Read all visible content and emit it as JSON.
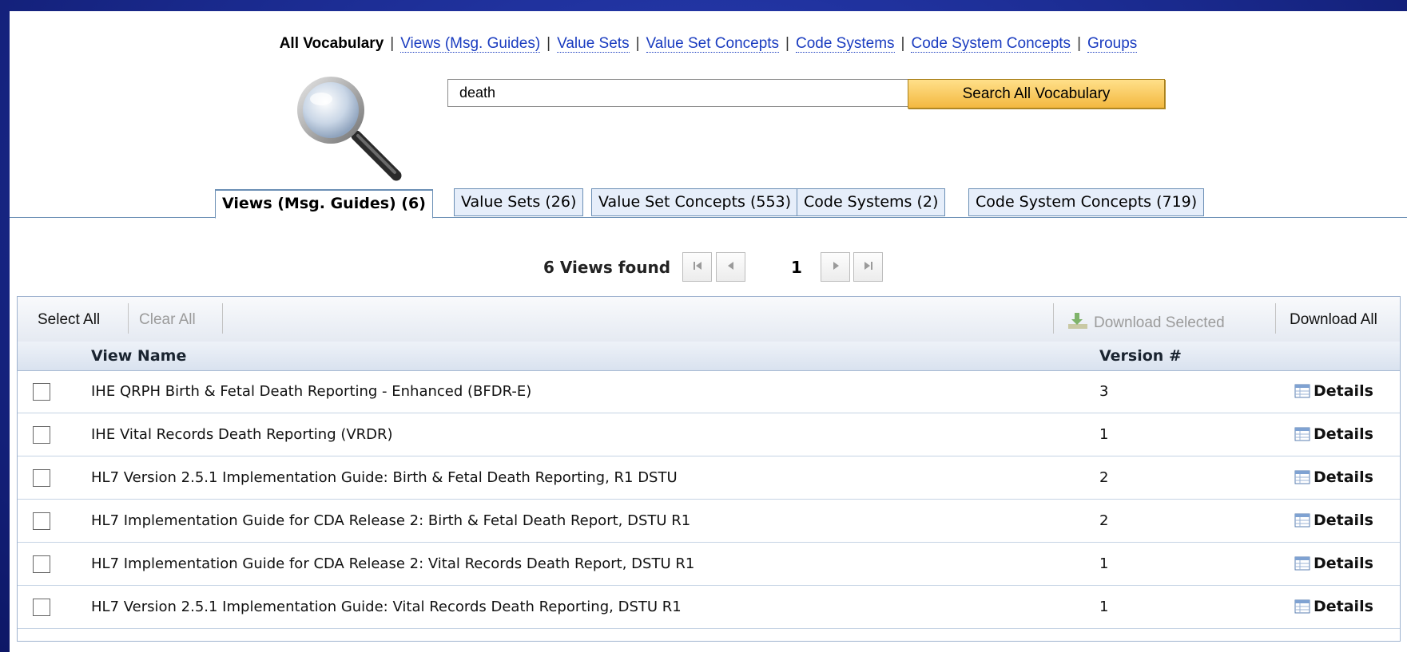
{
  "nav": {
    "current": "All Vocabulary",
    "links": [
      "Views (Msg. Guides)",
      "Value Sets",
      "Value Set Concepts",
      "Code Systems",
      "Code System Concepts",
      "Groups"
    ],
    "separator": "|"
  },
  "search": {
    "value": "death",
    "button_label": "Search All Vocabulary"
  },
  "tabs": [
    {
      "label": "Views (Msg. Guides) (6)",
      "active": true
    },
    {
      "label": "Value Sets (26)",
      "active": false
    },
    {
      "label": "Value Set Concepts (553)",
      "active": false
    },
    {
      "label": "Code Systems (2)",
      "active": false
    },
    {
      "label": "Code System Concepts (719)",
      "active": false
    }
  ],
  "pager": {
    "results_text": "6 Views found",
    "page": "1"
  },
  "toolbar": {
    "select_all": "Select All",
    "clear_all": "Clear All",
    "download_selected": "Download Selected",
    "download_all": "Download All"
  },
  "table": {
    "columns": [
      "View Name",
      "Version #"
    ],
    "details_label": "Details",
    "rows": [
      {
        "name": "IHE QRPH Birth & Fetal Death Reporting - Enhanced (BFDR-E)",
        "version": "3"
      },
      {
        "name": "IHE Vital Records Death Reporting (VRDR)",
        "version": "1"
      },
      {
        "name": "HL7 Version 2.5.1 Implementation Guide: Birth & Fetal Death Reporting, R1 DSTU",
        "version": "2"
      },
      {
        "name": "HL7 Implementation Guide for CDA Release 2: Birth & Fetal Death Report, DSTU R1",
        "version": "2"
      },
      {
        "name": "HL7 Implementation Guide for CDA Release 2: Vital Records Death Report, DSTU R1",
        "version": "1"
      },
      {
        "name": "HL7 Version 2.5.1 Implementation Guide: Vital Records Death Reporting, DSTU R1",
        "version": "1"
      }
    ]
  },
  "colors": {
    "background": "#1a2a8e",
    "link": "#1a3cc0",
    "tab_border": "#6b8fb5",
    "search_button": "#f3b840"
  }
}
